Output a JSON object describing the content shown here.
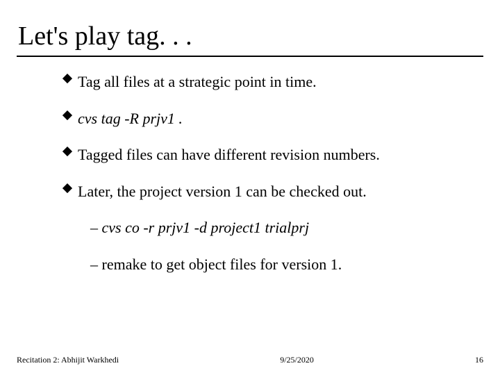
{
  "title": "Let's play tag. . .",
  "bullets": {
    "b1": "Tag all files at a strategic point in time.",
    "b2": "cvs tag -R prjv1 .",
    "b3": "Tagged files can have different revision numbers.",
    "b4": "Later, the project version 1 can be checked out."
  },
  "subs": {
    "s1": "cvs co -r prjv1 -d project1 trialprj",
    "s2": "remake to get object files for version 1."
  },
  "footer": {
    "left": "Recitation 2: Abhijit Warkhedi",
    "center": "9/25/2020",
    "right": "16"
  }
}
